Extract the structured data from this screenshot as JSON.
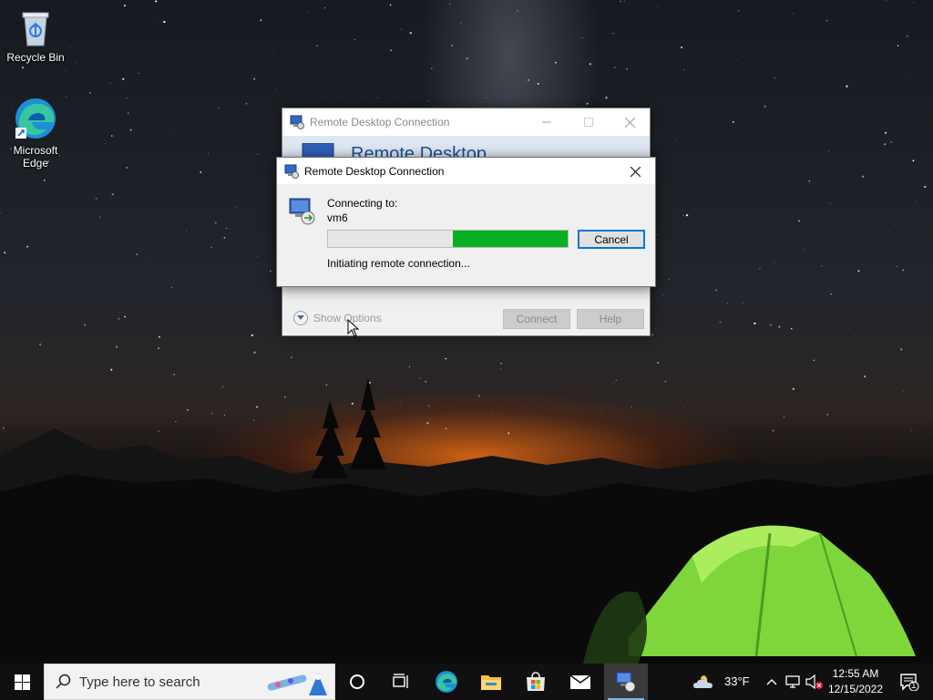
{
  "desktop": {
    "icons": [
      {
        "label": "Recycle Bin",
        "icon": "recycle-bin-icon"
      },
      {
        "label": "Microsoft Edge",
        "icon": "edge-icon"
      }
    ]
  },
  "bg_window": {
    "title": "Remote Desktop Connection",
    "header_text": "Remote Desktop",
    "show_options": "Show Options",
    "connect_label": "Connect",
    "help_label": "Help"
  },
  "dialog": {
    "title": "Remote Desktop Connection",
    "connecting_label": "Connecting to:",
    "target": "vm6",
    "progress_segment_start": 0.52,
    "progress_segment_end": 1.0,
    "progress_color": "#06b025",
    "cancel_label": "Cancel",
    "status": "Initiating remote connection..."
  },
  "taskbar": {
    "search_placeholder": "Type here to search",
    "pinned": [
      "cortana-icon",
      "task-view-icon",
      "edge-icon",
      "file-explorer-icon",
      "store-icon",
      "mail-icon",
      "remote-desktop-icon"
    ],
    "weather": "33°F",
    "time": "12:55 AM",
    "date": "12/15/2022",
    "notifications_count": "1"
  },
  "colors": {
    "accent": "#0078d7",
    "taskbar": "#101010",
    "header_text": "#1b4f99"
  }
}
